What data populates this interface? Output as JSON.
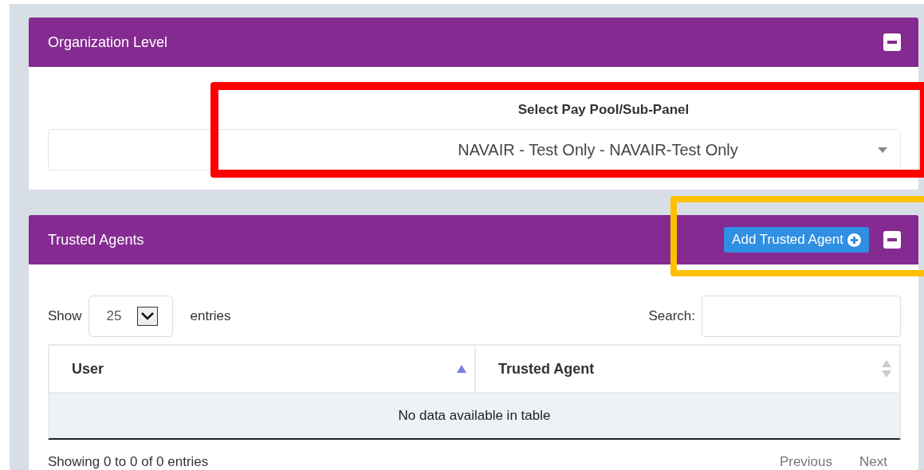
{
  "org_panel": {
    "title": "Organization Level",
    "collapsed": false,
    "select_label": "Select Pay Pool/Sub-Panel",
    "select_value": "NAVAIR - Test Only - NAVAIR-Test Only"
  },
  "agents_panel": {
    "title": "Trusted Agents",
    "collapsed": false,
    "add_button": "Add Trusted Agent",
    "length": {
      "label_before": "Show",
      "value": "25",
      "label_after": "entries"
    },
    "search": {
      "label": "Search:"
    },
    "columns": [
      {
        "label": "User",
        "sorted": true
      },
      {
        "label": "Trusted Agent",
        "sorted": false
      }
    ],
    "empty_message": "No data available in table",
    "info": "Showing 0 to 0 of 0 entries",
    "pagination": [
      {
        "label": "Previous",
        "disabled": true
      },
      {
        "label": "Next",
        "disabled": true
      }
    ]
  }
}
